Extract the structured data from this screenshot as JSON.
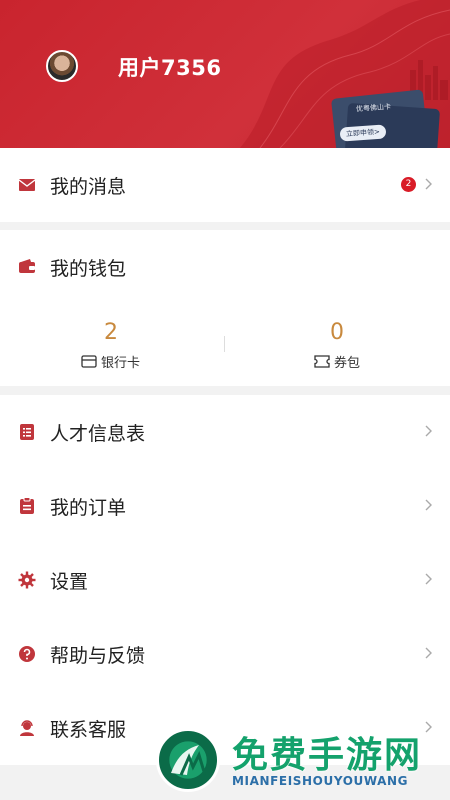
{
  "header": {
    "username": "用户7356",
    "card_title": "优粤佛山卡",
    "card_button": "立即申领>"
  },
  "menu": {
    "messages": {
      "label": "我的消息",
      "badge": "2"
    },
    "wallet": {
      "label": "我的钱包",
      "bank_card_count": "2",
      "bank_card_label": "银行卡",
      "coupon_count": "0",
      "coupon_label": "券包"
    },
    "talent_form": {
      "label": "人才信息表"
    },
    "orders": {
      "label": "我的订单"
    },
    "settings": {
      "label": "设置"
    },
    "help": {
      "label": "帮助与反馈"
    },
    "contact": {
      "label": "联系客服"
    }
  },
  "watermark": {
    "title": "免费手游网",
    "subtitle": "MIANFEISHOUYOUWANG"
  },
  "colors": {
    "brand_red": "#c9242e",
    "badge_red": "#d91c27",
    "wallet_gold": "#c8893d",
    "icon_red": "#c0363c"
  }
}
